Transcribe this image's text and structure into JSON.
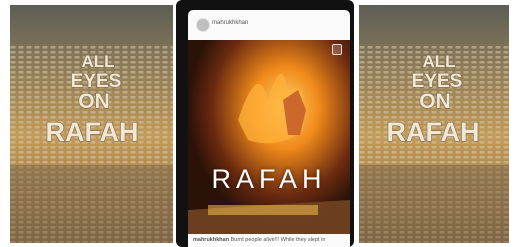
{
  "left_image": {
    "lines": [
      "ALL",
      "EYES",
      "ON",
      "RAFAH"
    ],
    "colors": {
      "sky": "#5c5e56",
      "ground": "#a8864f",
      "text": "#f1e7d2"
    }
  },
  "center_post": {
    "username": "mahrukhkhan",
    "overlay_title": "RAFAH",
    "caption_username": "mahrukhkhan",
    "caption_text": "Burnt people alive!!! While they slept in",
    "colors": {
      "background": "#111111",
      "fire": "#f08a1a",
      "header": "#fafafa"
    }
  },
  "right_image": {
    "lines": [
      "ALL",
      "EYES",
      "ON",
      "RAFAH"
    ]
  }
}
